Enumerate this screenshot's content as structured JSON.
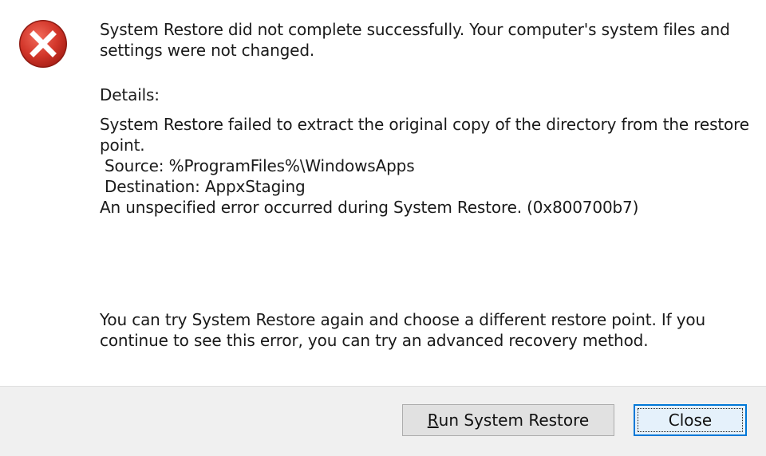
{
  "dialog": {
    "icon": "error-icon",
    "message": "System Restore did not complete successfully. Your computer's system files and settings were not changed.",
    "details_label": "Details:",
    "details_lines": [
      "System Restore failed to extract the original copy of the directory from the restore",
      "point.",
      " Source: %ProgramFiles%\\WindowsApps",
      " Destination: AppxStaging",
      "An unspecified error occurred during System Restore. (0x800700b7)"
    ],
    "advice": "You can try System Restore again and choose a different restore point. If you continue to see this error, you can try an advanced recovery method."
  },
  "buttons": {
    "run_accel": "R",
    "run_rest": "un System Restore",
    "close_label": "Close"
  },
  "colors": {
    "error_red": "#c42b1c",
    "focus_blue": "#0078d7",
    "footer_bg": "#f0f0f0"
  }
}
